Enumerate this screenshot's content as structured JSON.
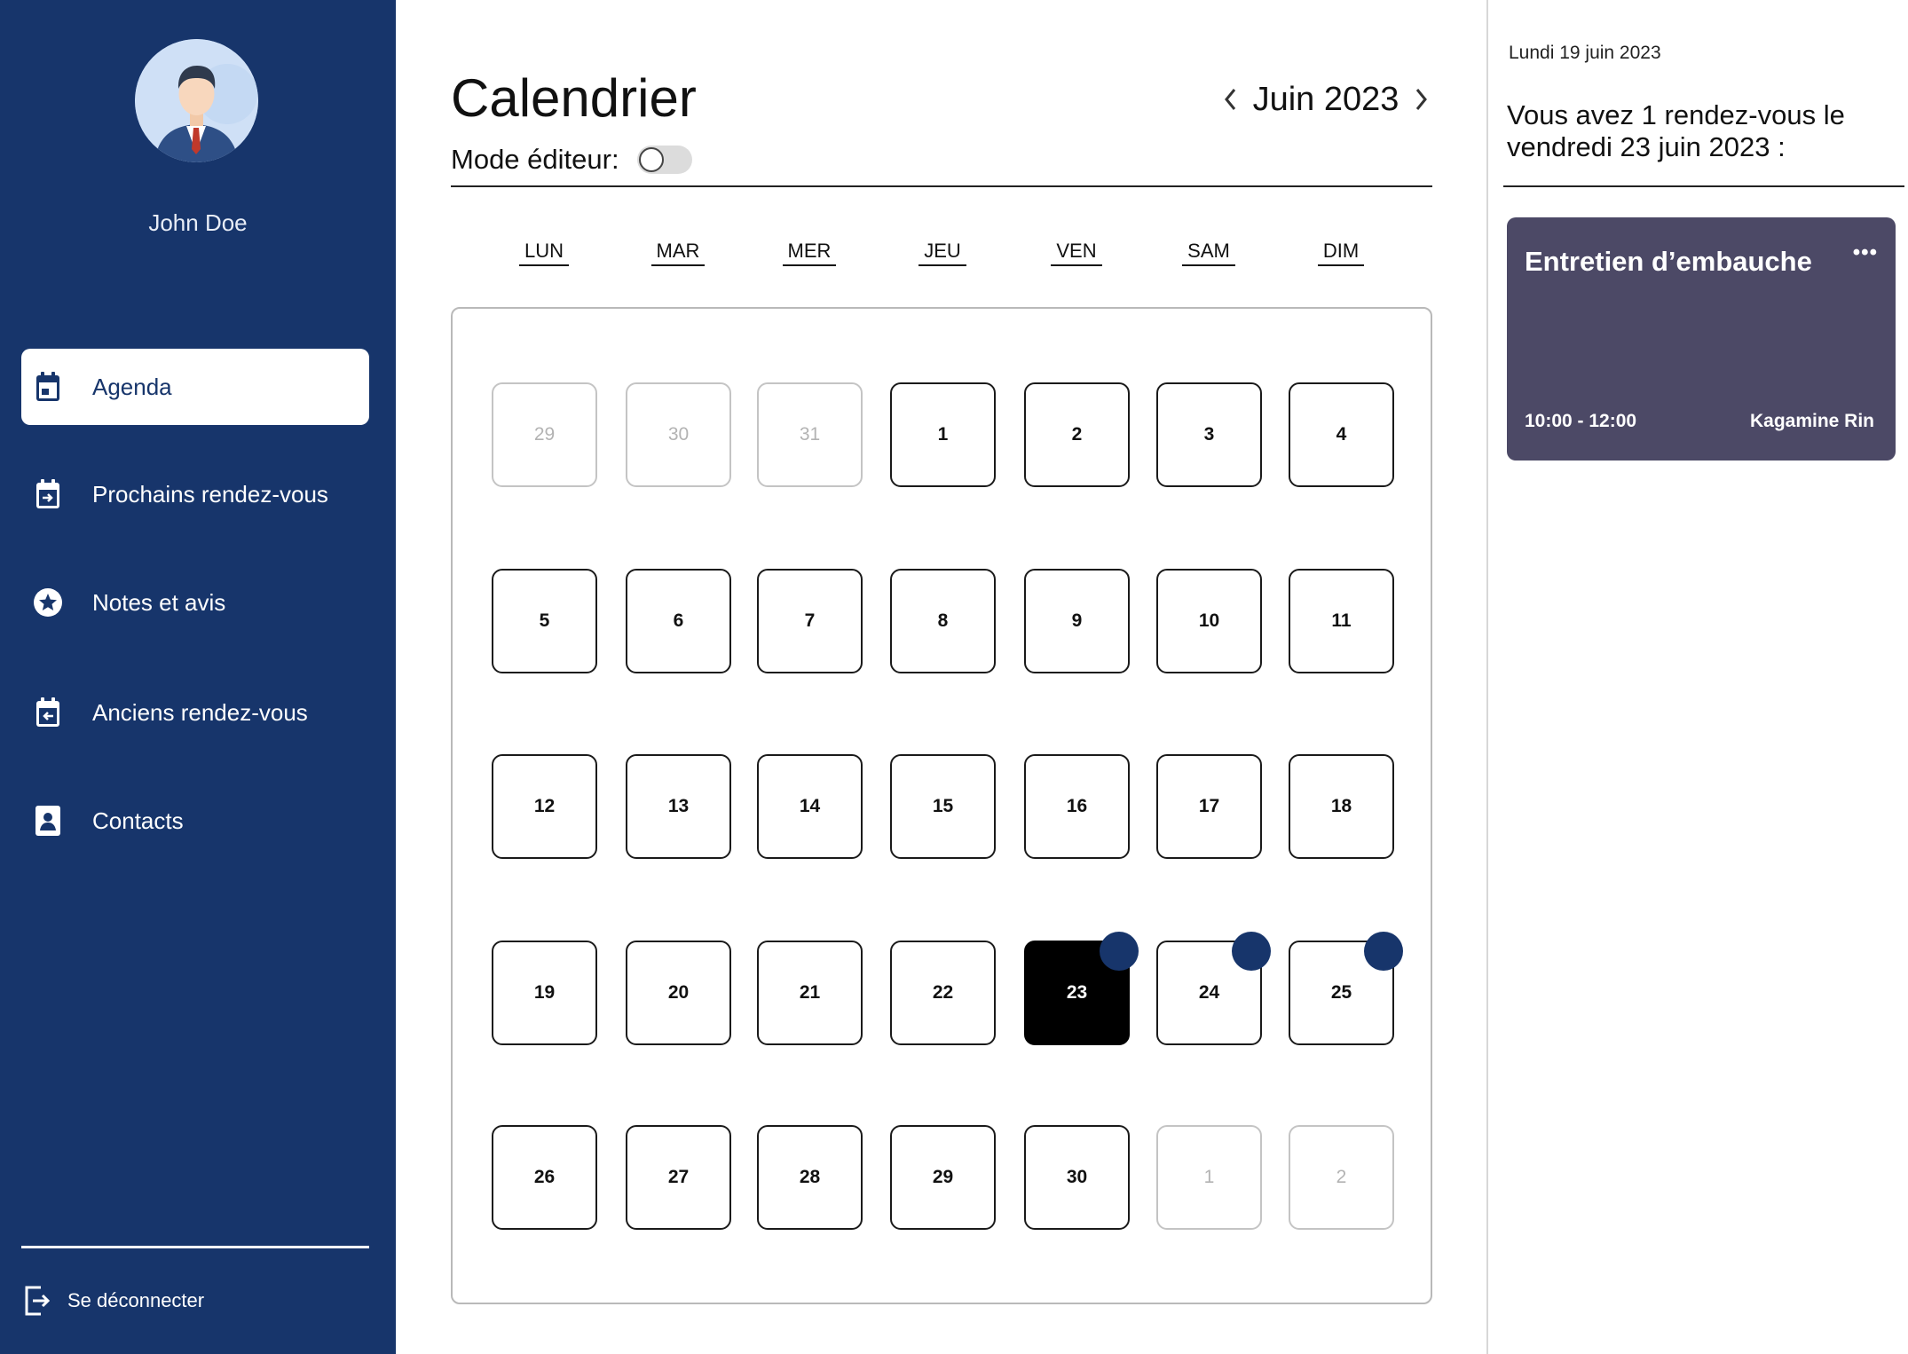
{
  "sidebar": {
    "user_name": "John Doe",
    "items": [
      {
        "label": "Agenda",
        "icon": "calendar-icon",
        "active": true
      },
      {
        "label": "Prochains rendez-vous",
        "icon": "calendar-forward-icon",
        "active": false
      },
      {
        "label": "Notes et avis",
        "icon": "star-badge-icon",
        "active": false
      },
      {
        "label": "Anciens rendez-vous",
        "icon": "calendar-back-icon",
        "active": false
      },
      {
        "label": "Contacts",
        "icon": "contact-card-icon",
        "active": false
      }
    ],
    "logout_label": "Se déconnecter",
    "colors": {
      "background": "#17356b",
      "active_bg": "#ffffff",
      "text": "#ffffff"
    }
  },
  "main": {
    "title": "Calendrier",
    "month_label": "Juin 2023",
    "editor_mode_label": "Mode éditeur:",
    "editor_mode_on": false,
    "weekdays": [
      "LUN",
      "MAR",
      "MER",
      "JEU",
      "VEN",
      "SAM",
      "DIM"
    ],
    "weeks": [
      [
        {
          "n": "29",
          "muted": true
        },
        {
          "n": "30",
          "muted": true
        },
        {
          "n": "31",
          "muted": true
        },
        {
          "n": "1"
        },
        {
          "n": "2"
        },
        {
          "n": "3"
        },
        {
          "n": "4"
        }
      ],
      [
        {
          "n": "5"
        },
        {
          "n": "6"
        },
        {
          "n": "7"
        },
        {
          "n": "8"
        },
        {
          "n": "9"
        },
        {
          "n": "10"
        },
        {
          "n": "11"
        }
      ],
      [
        {
          "n": "12"
        },
        {
          "n": "13"
        },
        {
          "n": "14"
        },
        {
          "n": "15"
        },
        {
          "n": "16"
        },
        {
          "n": "17"
        },
        {
          "n": "18"
        }
      ],
      [
        {
          "n": "19"
        },
        {
          "n": "20"
        },
        {
          "n": "21"
        },
        {
          "n": "22"
        },
        {
          "n": "23",
          "selected": true,
          "event": true
        },
        {
          "n": "24",
          "event": true
        },
        {
          "n": "25",
          "event": true
        }
      ],
      [
        {
          "n": "26"
        },
        {
          "n": "27"
        },
        {
          "n": "28"
        },
        {
          "n": "29"
        },
        {
          "n": "30"
        },
        {
          "n": "1",
          "muted": true
        },
        {
          "n": "2",
          "muted": true
        }
      ]
    ],
    "colors": {
      "selected_day": "#000000",
      "event_dot": "#17356b",
      "muted_border": "#c4c4c4"
    }
  },
  "panel": {
    "date": "Lundi 19 juin 2023",
    "summary": "Vous avez 1 rendez-vous le vendredi 23 juin 2023 :",
    "event": {
      "title": "Entretien d’embauche",
      "more": "•••",
      "time": "10:00 - 12:00",
      "person": "Kagamine Rin",
      "color": "#4c4966"
    }
  }
}
